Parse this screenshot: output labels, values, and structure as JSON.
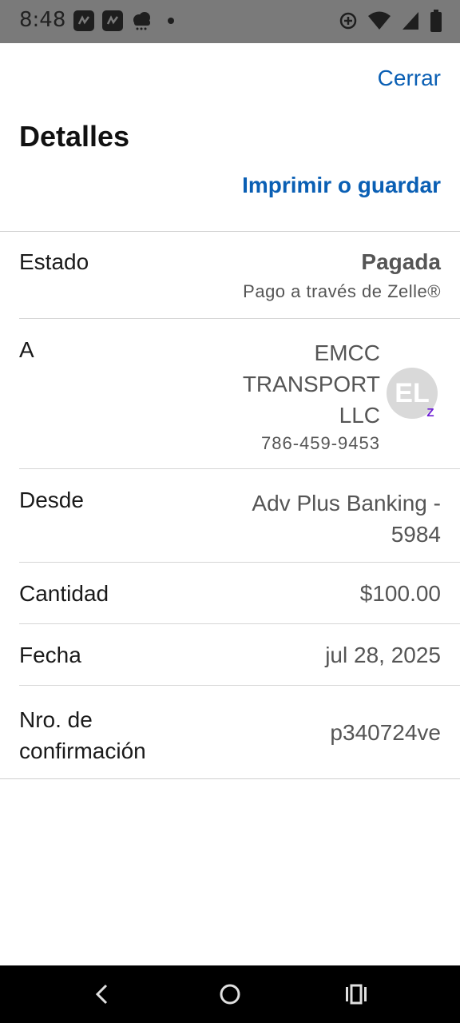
{
  "status_bar": {
    "time": "8:48"
  },
  "header": {
    "close_label": "Cerrar",
    "title": "Detalles",
    "print_label": "Imprimir o guardar"
  },
  "details": {
    "status": {
      "label": "Estado",
      "value": "Pagada",
      "sub": "Pago a través de Zelle®"
    },
    "to": {
      "label": "A",
      "name_line1": "EMCC",
      "name_line2": "TRANSPORT",
      "name_line3": "LLC",
      "phone": "786-459-9453",
      "avatar_initials": "EL",
      "badge": "Z"
    },
    "from": {
      "label": "Desde",
      "value_line1": "Adv Plus Banking -",
      "value_line2": "5984"
    },
    "amount": {
      "label": "Cantidad",
      "value": "$100.00"
    },
    "date": {
      "label": "Fecha",
      "value": "jul 28, 2025"
    },
    "confirmation": {
      "label_line1": "Nro. de",
      "label_line2": "confirmación",
      "value": "p340724ve"
    }
  },
  "colors": {
    "link": "#0a5fb4",
    "zelle": "#6d1ed4",
    "status_bar": "#7a7a7a"
  }
}
